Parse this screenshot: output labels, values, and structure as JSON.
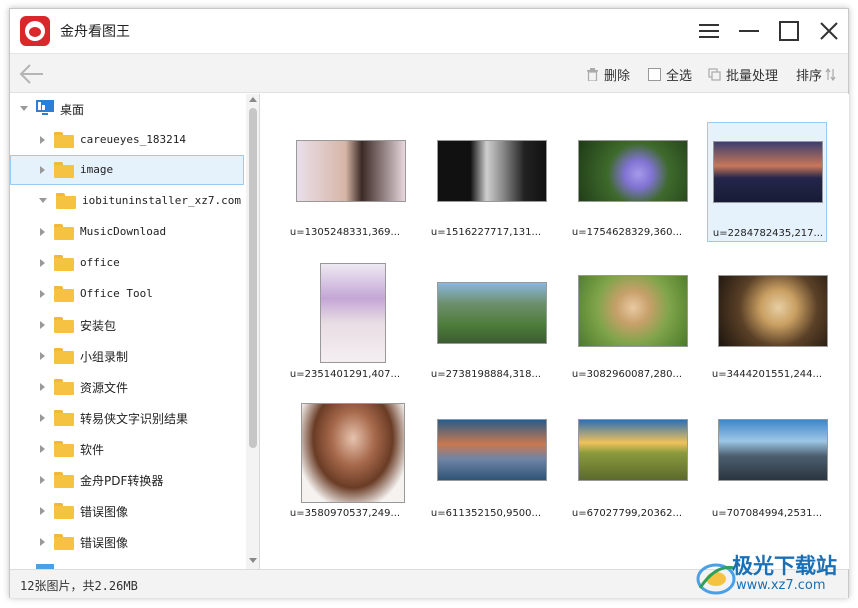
{
  "window": {
    "title": "金舟看图王"
  },
  "toolbar": {
    "delete_label": "删除",
    "selectall_label": "全选",
    "batch_label": "批量处理",
    "sort_label": "排序"
  },
  "sidebar": {
    "root_label": "桌面",
    "items": [
      {
        "label": "careueyes_183214"
      },
      {
        "label": "image"
      },
      {
        "label": "iobituninstaller_xz7.com"
      },
      {
        "label": "MusicDownload"
      },
      {
        "label": "office"
      },
      {
        "label": "Office Tool"
      },
      {
        "label": "安装包"
      },
      {
        "label": "小组录制"
      },
      {
        "label": "资源文件"
      },
      {
        "label": "转易侠文字识别结果"
      },
      {
        "label": "软件"
      },
      {
        "label": "金舟PDF转换器"
      },
      {
        "label": "错误图像"
      },
      {
        "label": "错误图像"
      }
    ]
  },
  "thumbnails": [
    {
      "caption": "u=1305248331,369..."
    },
    {
      "caption": "u=1516227717,131..."
    },
    {
      "caption": "u=1754628329,360..."
    },
    {
      "caption": "u=2284782435,217..."
    },
    {
      "caption": "u=2351401291,407..."
    },
    {
      "caption": "u=2738198884,318..."
    },
    {
      "caption": "u=3082960087,280..."
    },
    {
      "caption": "u=3444201551,244..."
    },
    {
      "caption": "u=3580970537,249..."
    },
    {
      "caption": "u=611352150,9500..."
    },
    {
      "caption": "u=67027799,20362..."
    },
    {
      "caption": "u=707084994,2531..."
    }
  ],
  "status": {
    "text": "12张图片，共2.26MB"
  },
  "watermark": {
    "brand": "极光下载站",
    "url": "www.xz7.com"
  },
  "colors": {
    "accent": "#d9282c",
    "selection": "#e5f1fb",
    "folder": "#f5c242",
    "watermark": "#1a6fb5"
  }
}
